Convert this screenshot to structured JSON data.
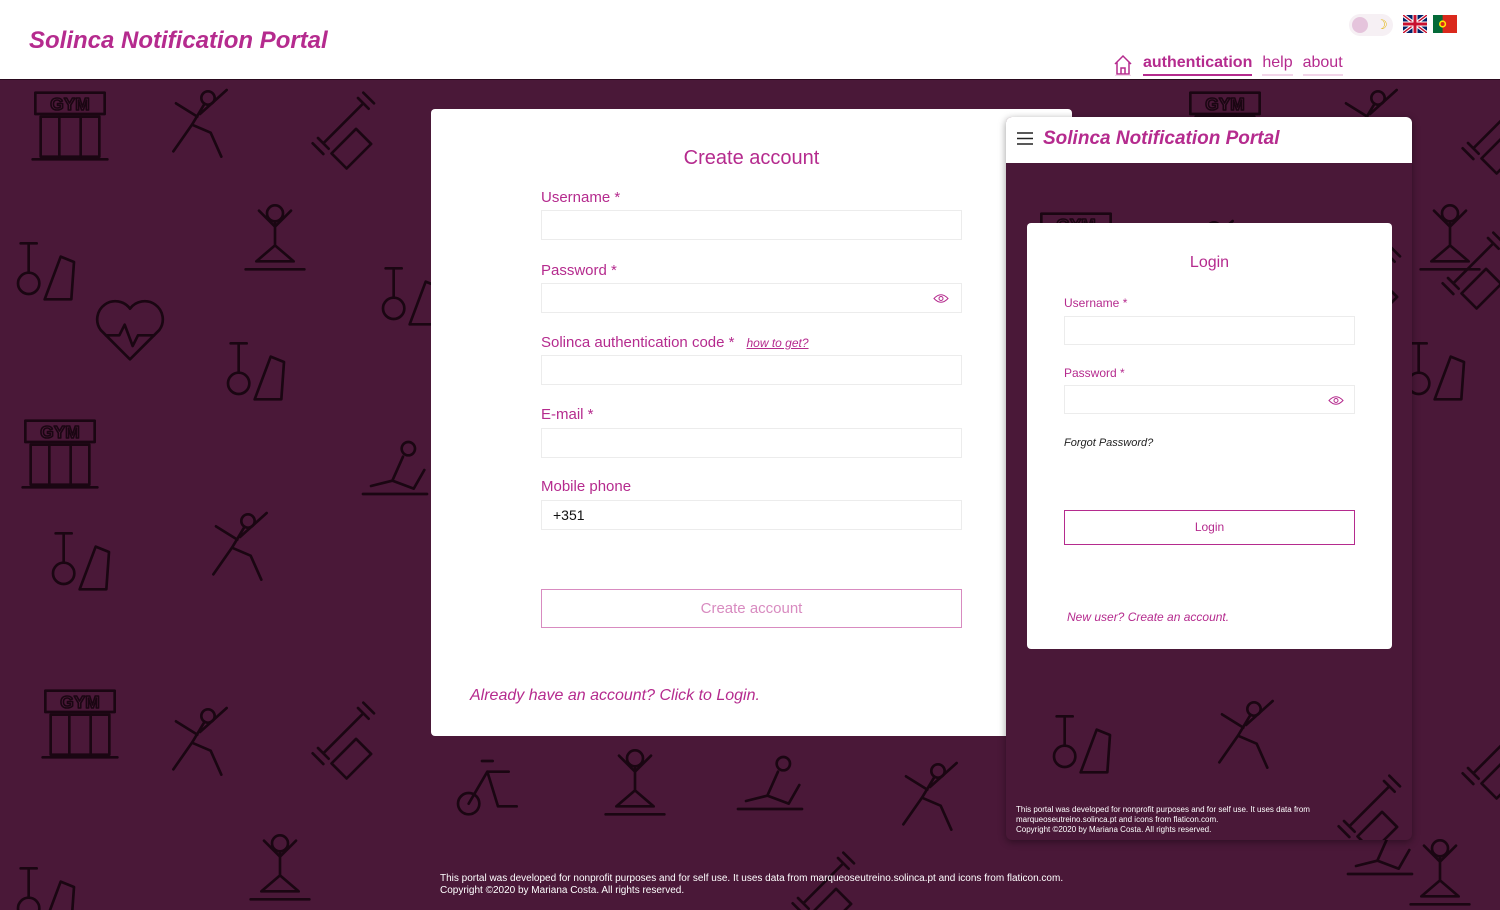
{
  "header": {
    "brand": "Solinca Notification Portal",
    "nav": {
      "authentication": "authentication",
      "help": "help",
      "about": "about"
    },
    "theme_toggle_icon": "moon-icon",
    "languages": [
      "uk-flag-icon",
      "pt-flag-icon"
    ]
  },
  "create_account": {
    "title": "Create account",
    "username_label": "Username *",
    "password_label": "Password *",
    "auth_code_label": "Solinca authentication code *",
    "auth_code_hint": "how to get?",
    "email_label": "E-mail *",
    "phone_label": "Mobile phone",
    "phone_value": "+351",
    "submit_label": "Create account",
    "login_link": "Already have an account? Click to Login."
  },
  "mobile_preview": {
    "brand": "Solinca Notification Portal",
    "login": {
      "title": "Login",
      "username_label": "Username *",
      "password_label": "Password *",
      "forgot": "Forgot Password?",
      "submit_label": "Login",
      "new_user": "New user? Create an account."
    },
    "footer_line1": "This portal was developed for nonprofit purposes and for self use. It uses data from",
    "footer_line2": "marqueoseutreino.solinca.pt and icons from flaticon.com.",
    "footer_line3": "Copyright ©2020 by Mariana Costa. All rights reserved."
  },
  "footer": {
    "line1": "This portal was developed for nonprofit purposes and for self use. It uses data from marqueoseutreino.solinca.pt and icons from flaticon.com.",
    "line2": "Copyright ©2020 by Mariana Costa. All rights reserved."
  },
  "colors": {
    "accent": "#b52b8e",
    "background": "#4a1838",
    "pattern": "#1a0612",
    "light_accent": "#d88bc0"
  }
}
